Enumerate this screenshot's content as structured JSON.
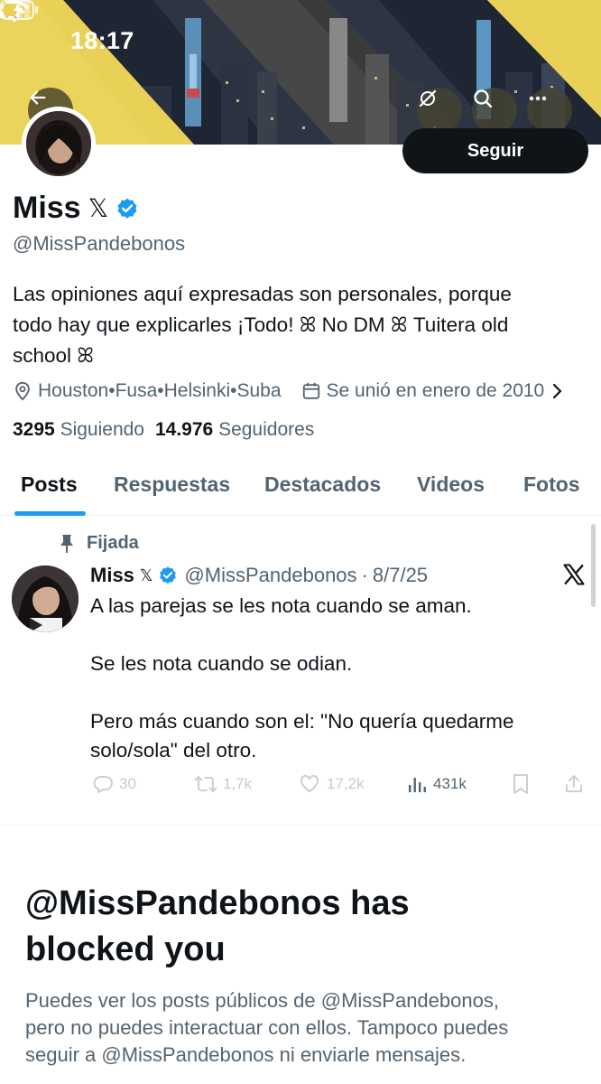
{
  "status_bar": {
    "time": "18:17",
    "icons": [
      "bell-slash-icon",
      "cellular-signal-icon",
      "wifi-icon",
      "battery-charging-icon"
    ]
  },
  "header_actions": {
    "back": "arrow-left-icon",
    "grok": "grok-icon",
    "search": "search-icon",
    "more": "ellipsis-icon"
  },
  "profile": {
    "name": "Miss",
    "x_mark": "𝕏",
    "verified": true,
    "handle": "@MissPandebonos",
    "follow_label": "Seguir",
    "bio_line1": "Las opiniones aquí expresadas son personales, porque",
    "bio_line2": "todo hay que explicarles ¡Todo! ꕤ No DM ꕤ Tuitera old",
    "bio_line3": "school ꕤ",
    "location": "Houston•Fusa•Helsinki•Suba",
    "joined": "Se unió en enero de 2010",
    "following_count": "3295",
    "following_label": "Siguiendo",
    "followers_count": "14.976",
    "followers_label": "Seguidores"
  },
  "tabs": [
    {
      "label": "Posts",
      "active": true
    },
    {
      "label": "Respuestas",
      "active": false
    },
    {
      "label": "Destacados",
      "active": false
    },
    {
      "label": "Videos",
      "active": false
    },
    {
      "label": "Fotos",
      "active": false
    }
  ],
  "pinned_post": {
    "pinned_label": "Fijada",
    "author_name": "Miss",
    "x_mark": "𝕏",
    "handle": "@MissPandebonos",
    "separator": "·",
    "date": "8/7/25",
    "text_line1": "A las parejas se les nota cuando se aman.",
    "text_line2": "Se les nota cuando se odian.",
    "text_line3": "Pero más cuando son el: \"No quería quedarme",
    "text_line4": "solo/sola\" del otro.",
    "replies": "30",
    "reposts": "1,7k",
    "likes": "17,2k",
    "views": "431k"
  },
  "blocked": {
    "title_line1": "@MissPandebonos has",
    "title_line2": "blocked you",
    "desc_line1": "Puedes ver los posts públicos de @MissPandebonos,",
    "desc_line2": "pero no puedes interactuar con ellos. Tampoco puedes",
    "desc_line3": "seguir a @MissPandebonos ni enviarle mensajes."
  },
  "colors": {
    "accent": "#1d9bf0",
    "text_primary": "#0f1419",
    "text_secondary": "#536471",
    "banner_yellow": "#e9d158"
  }
}
